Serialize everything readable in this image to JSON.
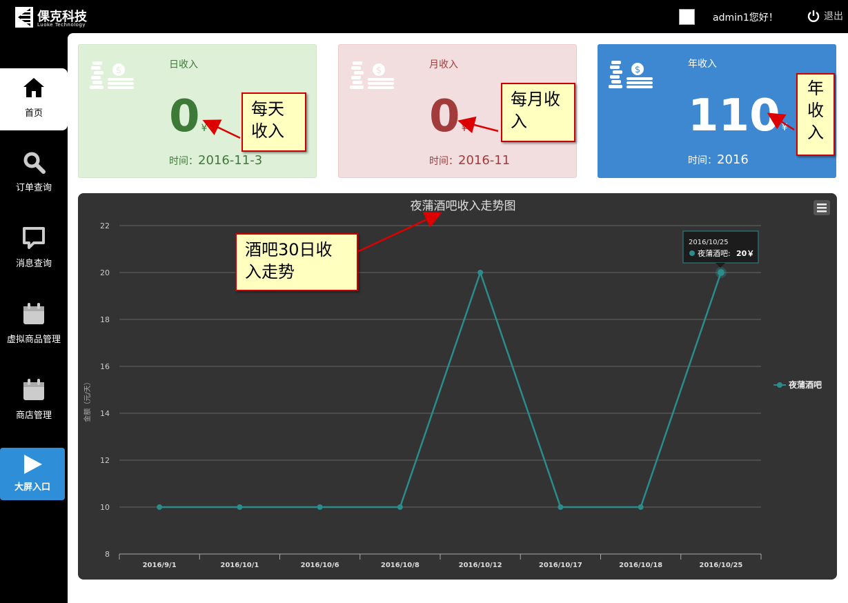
{
  "header": {
    "logo_cn": "倮克科技",
    "logo_en": "Luoke Technology",
    "greeting": "admin1您好！",
    "logout": "退出"
  },
  "sidebar": {
    "items": [
      {
        "label": "首页",
        "icon": "home-icon"
      },
      {
        "label": "订单查询",
        "icon": "search-icon"
      },
      {
        "label": "消息查询",
        "icon": "message-icon"
      },
      {
        "label": "虚拟商品管理",
        "icon": "calendar-icon"
      },
      {
        "label": "商店管理",
        "icon": "calendar-icon"
      },
      {
        "label": "大屏入口",
        "icon": "play-icon"
      }
    ]
  },
  "cards": {
    "daily": {
      "title": "日收入",
      "value": "0",
      "unit": "¥",
      "time_label": "时间：",
      "time": "2016-11-3",
      "color": "#3d7a37"
    },
    "monthly": {
      "title": "月收入",
      "value": "0",
      "unit": "¥",
      "time_label": "时间：",
      "time": "2016-11",
      "color": "#a23c3c"
    },
    "yearly": {
      "title": "年收入",
      "value": "110",
      "unit": "¥",
      "time_label": "时间：",
      "time": "2016",
      "color": "#ffffff"
    }
  },
  "callouts": {
    "daily": "每天收入",
    "monthly": "每月收入",
    "yearly": "年收入",
    "chart": "酒吧30日收入走势"
  },
  "chart_data": {
    "type": "line",
    "title": "夜蒲酒吧收入走势图",
    "ylabel": "金额（元/天）",
    "xlabel": "",
    "categories": [
      "2016/9/1",
      "2016/10/1",
      "2016/10/6",
      "2016/10/8",
      "2016/10/12",
      "2016/10/17",
      "2016/10/18",
      "2016/10/25"
    ],
    "series": [
      {
        "name": "夜蒲酒吧",
        "values": [
          10,
          10,
          10,
          10,
          20,
          10,
          10,
          20
        ],
        "color": "#2b8c8c"
      }
    ],
    "ylim": [
      8,
      22
    ],
    "yticks": [
      8,
      10,
      12,
      14,
      16,
      18,
      20,
      22
    ],
    "grid": true,
    "legend": "right",
    "tooltip": {
      "date": "2016/10/25",
      "label": "夜蒲酒吧:",
      "value": "20￥"
    }
  }
}
